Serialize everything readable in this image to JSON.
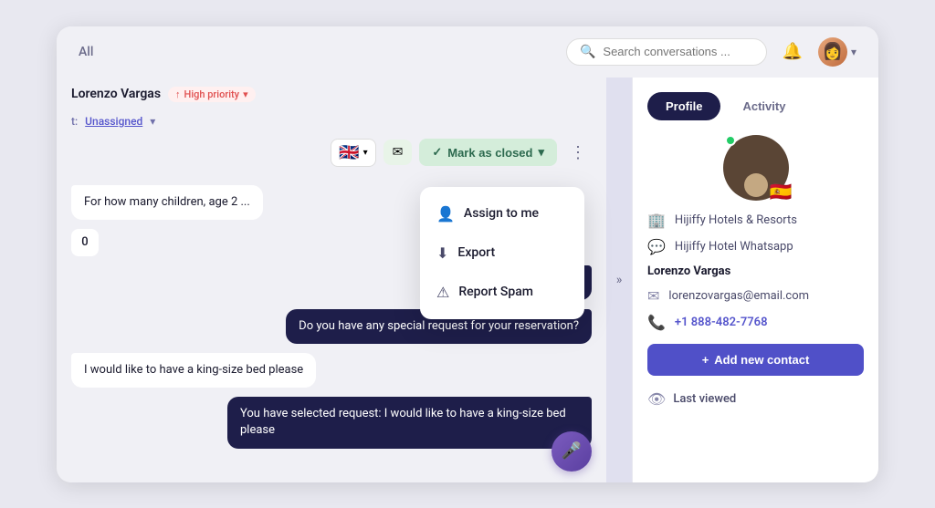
{
  "header": {
    "all_label": "All",
    "search_placeholder": "Search conversations ...",
    "bell_icon": "bell-icon",
    "avatar_icon": "user-avatar-icon",
    "chevron_icon": "chevron-down-icon"
  },
  "chat": {
    "contact_name": "Lorenzo Vargas",
    "priority_label": "High priority",
    "assign_label": "Unassigned",
    "flag_emoji": "🇬🇧",
    "mark_closed_label": "Mark as closed",
    "messages": [
      {
        "id": 1,
        "text": "For how many children, age 2 ...",
        "type": "incoming"
      },
      {
        "id": 2,
        "text": "0",
        "type": "counter"
      },
      {
        "id": 3,
        "text": "You...",
        "type": "outgoing"
      },
      {
        "id": 4,
        "text": "Do you have any special request for your reservation?",
        "type": "outgoing"
      },
      {
        "id": 5,
        "text": "I would like to have a king-size bed please",
        "type": "incoming"
      },
      {
        "id": 6,
        "text": "You have selected request: I would like to have a king-size bed please",
        "type": "outgoing"
      }
    ]
  },
  "dropdown": {
    "items": [
      {
        "id": 1,
        "label": "Assign to me",
        "icon": "person-icon"
      },
      {
        "id": 2,
        "label": "Export",
        "icon": "download-icon"
      },
      {
        "id": 3,
        "label": "Report Spam",
        "icon": "warning-icon"
      }
    ]
  },
  "profile": {
    "tabs": [
      {
        "id": "profile",
        "label": "Profile",
        "active": true
      },
      {
        "id": "activity",
        "label": "Activity",
        "active": false
      }
    ],
    "company": "Hijiffy Hotels & Resorts",
    "channel": "Hijiffy Hotel Whatsapp",
    "name": "Lorenzo Vargas",
    "email": "lorenzovargas@email.com",
    "phone": "+1 888-482-7768",
    "flag_emoji": "🇪🇸",
    "add_contact_label": "+ Add new contact",
    "last_viewed_label": "Last viewed"
  }
}
